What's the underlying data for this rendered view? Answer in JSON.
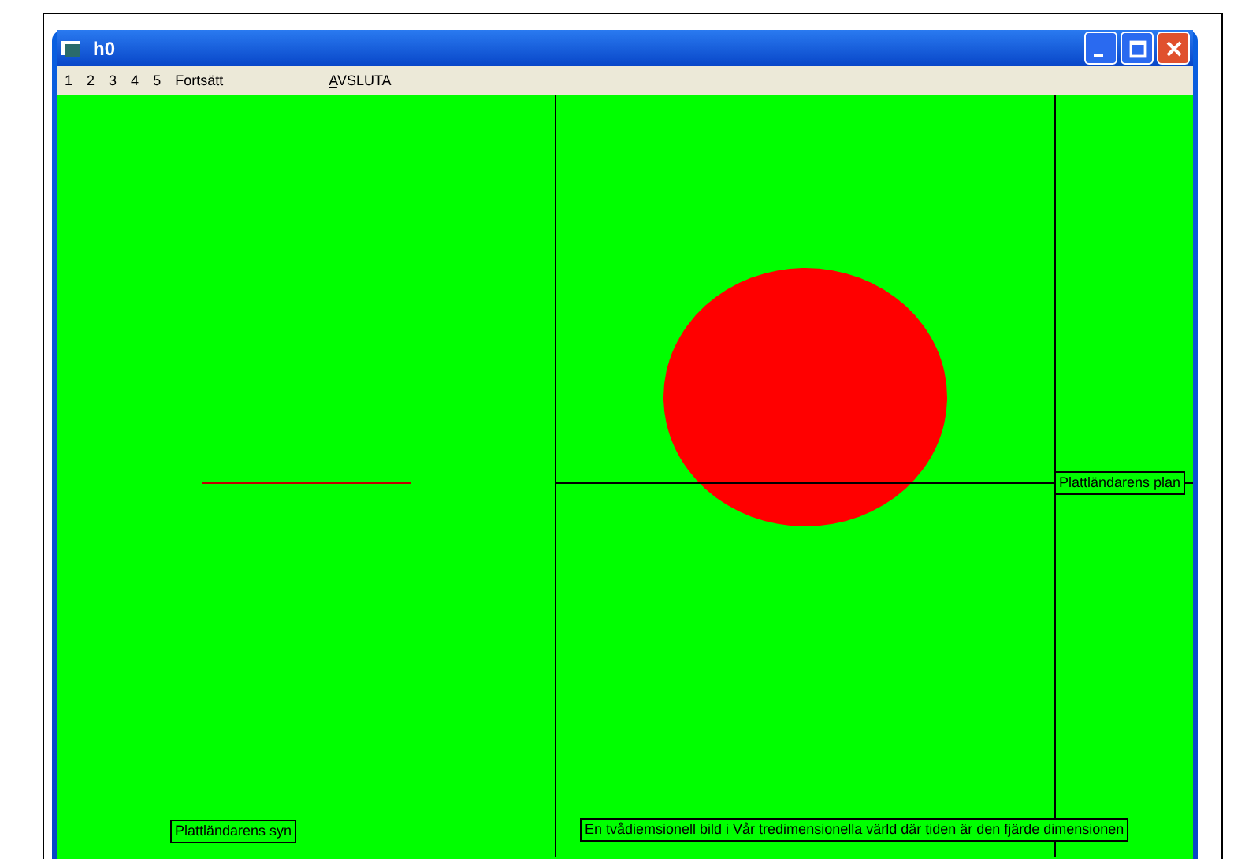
{
  "window": {
    "title": "h0"
  },
  "menu": [
    {
      "label": "1",
      "mnemonic": false
    },
    {
      "label": "2",
      "mnemonic": false
    },
    {
      "label": "3",
      "mnemonic": false
    },
    {
      "label": "4",
      "mnemonic": false
    },
    {
      "label": "5",
      "mnemonic": false
    },
    {
      "label": "Fortsätt",
      "mnemonic": false
    },
    {
      "label": "AVSLUTA",
      "mnemonic": true
    }
  ],
  "canvas": {
    "labels": [
      {
        "kind": "plan",
        "text": "Plattländarens plan"
      },
      {
        "kind": "view",
        "text": "Plattländarens syn"
      },
      {
        "kind": "caption",
        "text": "En tvådiemsionell bild i  Vår tredimensionella värld där tiden är den fjärde dimensionen"
      }
    ]
  }
}
